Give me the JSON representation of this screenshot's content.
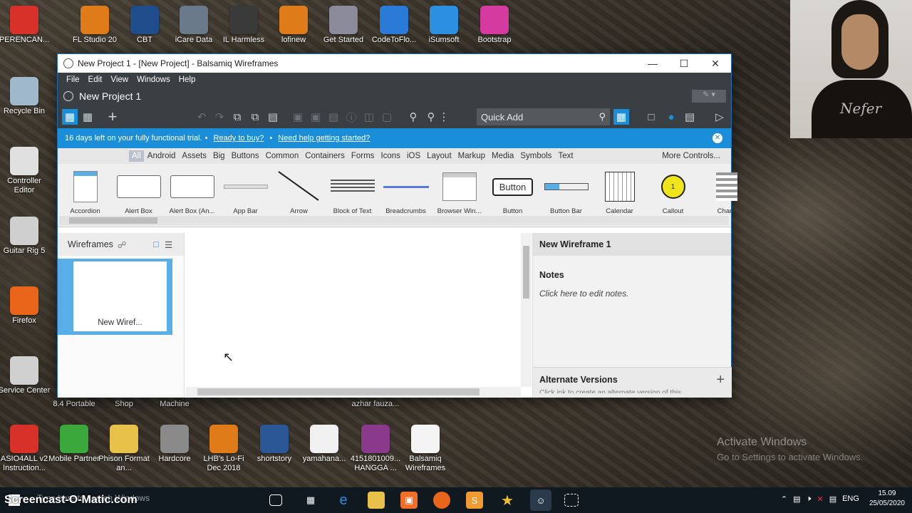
{
  "desktop": {
    "top_icons": [
      {
        "label": "PERENCAN...",
        "icon": "pdf-icon",
        "color": "#d8312a"
      },
      {
        "label": "FL Studio 20",
        "icon": "fruit-icon",
        "color": "#e07b1a"
      },
      {
        "label": "CBT",
        "icon": "graduation-icon",
        "color": "#1f4d8c"
      },
      {
        "label": "iCare Data",
        "icon": "icare-icon",
        "color": "#6a7a8a"
      },
      {
        "label": "IL Harmless",
        "icon": "il-icon",
        "color": "#3a3a3a"
      },
      {
        "label": "lofinew",
        "icon": "fruit-icon",
        "color": "#e07b1a"
      },
      {
        "label": "Get Started",
        "icon": "database-icon",
        "color": "#8a8a9a"
      },
      {
        "label": "CodeToFlo...",
        "icon": "globe-icon",
        "color": "#2a7bd8"
      },
      {
        "label": "iSumsoft",
        "icon": "ie-icon",
        "color": "#2d8fe0"
      },
      {
        "label": "Bootstrap",
        "icon": "bootstrap-icon",
        "color": "#d43aa0"
      }
    ],
    "left_icons": [
      {
        "label": "Recycle Bin",
        "icon": "recycle-bin-icon",
        "color": "#9fb8cc"
      },
      {
        "label": "Controller Editor",
        "icon": "controller-icon",
        "color": "#e0e0e0"
      },
      {
        "label": "Guitar Rig 5",
        "icon": "guitar-rig-icon",
        "color": "#cfcfcf"
      },
      {
        "label": "Firefox",
        "icon": "firefox-icon",
        "color": "#e8651a"
      },
      {
        "label": "Service Center",
        "icon": "service-center-icon",
        "color": "#d0d0d0"
      }
    ],
    "mid_labels": [
      "8.4 Portable",
      "Shop",
      "Machine",
      "azhar fauza..."
    ],
    "bottom_icons": [
      {
        "label": "ASIO4ALL v2 Instruction...",
        "icon": "pdf-icon",
        "color": "#d8312a"
      },
      {
        "label": "Mobile Partner",
        "icon": "mobile-partner-icon",
        "color": "#3aa83a"
      },
      {
        "label": "Phison Format an...",
        "icon": "folder-icon",
        "color": "#e8c14a"
      },
      {
        "label": "Hardcore",
        "icon": "usb-icon",
        "color": "#8a8a8a"
      },
      {
        "label": "LHB's Lo-Fi Dec 2018",
        "icon": "fruit-icon",
        "color": "#e07b1a"
      },
      {
        "label": "shortstory",
        "icon": "word-icon",
        "color": "#2b5797"
      },
      {
        "label": "yamahana...",
        "icon": "document-icon",
        "color": "#f0f0f0"
      },
      {
        "label": "4151801009... HANGGA ...",
        "icon": "winrar-icon",
        "color": "#8a3a8a"
      },
      {
        "label": "Balsamiq Wireframes",
        "icon": "balsamiq-icon",
        "color": "#f4f4f4"
      }
    ]
  },
  "window": {
    "title": "New Project 1 - [New Project] - Balsamiq Wireframes",
    "menu": [
      "File",
      "Edit",
      "View",
      "Windows",
      "Help"
    ],
    "project_name": "New Project 1",
    "quick_add_placeholder": "Quick Add",
    "trial": {
      "text": "16 days left on your fully functional trial.",
      "link1": "Ready to buy?",
      "link2": "Need help getting started?"
    },
    "categories": [
      "All",
      "Android",
      "Assets",
      "Big",
      "Buttons",
      "Common",
      "Containers",
      "Forms",
      "Icons",
      "iOS",
      "Layout",
      "Markup",
      "Media",
      "Symbols",
      "Text"
    ],
    "active_category": "All",
    "more_controls": "More Controls...",
    "library": [
      {
        "label": "Accordion",
        "icon": "accordion-icon"
      },
      {
        "label": "Alert Box",
        "icon": "alert-box-icon"
      },
      {
        "label": "Alert Box (An...",
        "icon": "alert-box-android-icon"
      },
      {
        "label": "App Bar",
        "icon": "app-bar-icon"
      },
      {
        "label": "Arrow",
        "icon": "arrow-icon"
      },
      {
        "label": "Block of Text",
        "icon": "block-of-text-icon"
      },
      {
        "label": "Breadcrumbs",
        "icon": "breadcrumbs-icon"
      },
      {
        "label": "Browser Win...",
        "icon": "browser-window-icon"
      },
      {
        "label": "Button",
        "icon": "button-icon",
        "text": "Button"
      },
      {
        "label": "Button Bar",
        "icon": "button-bar-icon"
      },
      {
        "label": "Calendar",
        "icon": "calendar-icon"
      },
      {
        "label": "Callout",
        "icon": "callout-icon",
        "text": "1"
      },
      {
        "label": "Chart:",
        "icon": "chart-icon"
      }
    ],
    "left_panel": {
      "title": "Wireframes",
      "thumb_label": "New Wiref..."
    },
    "right_panel": {
      "title": "New Wireframe 1",
      "notes_heading": "Notes",
      "notes_placeholder": "Click here to edit notes.",
      "alternate_heading": "Alternate Versions",
      "alternate_sub": "Click ink to create an alternate version of this"
    }
  },
  "overlay": {
    "activate_title": "Activate Windows",
    "activate_sub": "Go to Settings to activate Windows."
  },
  "taskbar": {
    "watermark": "Screencast-O-Matic.com",
    "search_placeholder": "Type here to search Windows",
    "language": "ENG",
    "time": "15.09",
    "date": "25/05/2020"
  }
}
